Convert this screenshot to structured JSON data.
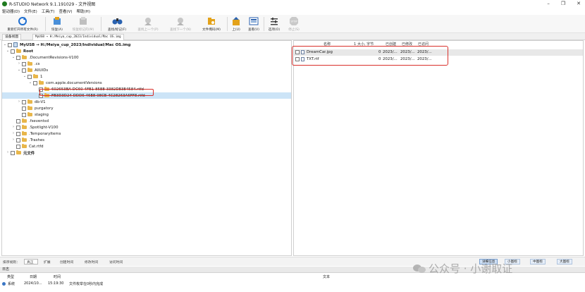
{
  "window": {
    "title": "R-STUDIO Network 9.1.191029 - 文件视图",
    "controls": [
      "–",
      "❐",
      "✕"
    ]
  },
  "menu": [
    "驱动器(D)",
    "文件(E)",
    "工具(T)",
    "查看(V)",
    "帮助(H)"
  ],
  "toolbar": [
    {
      "label": "重新打开所有文件(R)",
      "icon": "refresh-icon",
      "enabled": true
    },
    {
      "label": "恢复(A)",
      "icon": "recover-icon",
      "enabled": true
    },
    {
      "label": "恢复标记的(M)",
      "icon": "recover-marked-icon",
      "enabled": false
    },
    {
      "label": "查找/标记(F)",
      "icon": "binoculars-icon",
      "enabled": true
    },
    {
      "label": "查找上一个(P)",
      "icon": "find-prev-icon",
      "enabled": false
    },
    {
      "label": "查找下一个(N)",
      "icon": "find-next-icon",
      "enabled": false
    },
    {
      "label": "文件掩码(M)",
      "icon": "file-mask-icon",
      "enabled": true
    },
    {
      "label": "上(U)",
      "icon": "up-icon",
      "enabled": true
    },
    {
      "label": "查看(V)",
      "icon": "view-icon",
      "enabled": true
    },
    {
      "label": "选项(O)",
      "icon": "options-icon",
      "enabled": true
    },
    {
      "label": "停止(S)",
      "icon": "stop-icon",
      "enabled": false
    }
  ],
  "tabs": [
    {
      "label": "设备视图"
    },
    {
      "label": "MyUSB → H:/Meiya_cup_2023/Individual/Mac OS.img"
    }
  ],
  "tree": [
    {
      "label": "MyUSB → H:/Meiya_cup_2023/Individual/Mac OS.img",
      "bold": true,
      "expanded": true,
      "type": "drive",
      "highlight": false
    },
    {
      "label": "Root",
      "bold": true,
      "expanded": true,
      "type": "folder",
      "highlight": false
    },
    {
      "label": ".DocumentRevisions-V100",
      "expanded": true,
      "type": "folder",
      "highlight": false
    },
    {
      "label": ".cs",
      "expanded": false,
      "type": "folder",
      "highlight": false
    },
    {
      "label": "AllUIDs",
      "expanded": true,
      "type": "folder",
      "highlight": false
    },
    {
      "label": "1",
      "expanded": true,
      "type": "folder",
      "highlight": false
    },
    {
      "label": "com.apple.documentVersions",
      "expanded": true,
      "type": "folder",
      "highlight": false
    },
    {
      "label": "602653BA-DC60-4FB1-85EE-3382DE3E4584.rtfd",
      "type": "folder",
      "highlight": false
    },
    {
      "label": "FB3D3D24-DDD6-46E8-98CE-4C28263A6FF8.rtfd",
      "type": "folder",
      "highlight": true
    },
    {
      "label": "db-V1",
      "expanded": false,
      "type": "folder",
      "highlight": false
    },
    {
      "label": "purgatory",
      "type": "folder",
      "highlight": false
    },
    {
      "label": "staging",
      "type": "folder",
      "highlight": false
    },
    {
      "label": ".fseventsd",
      "type": "folder",
      "highlight": false
    },
    {
      "label": ".Spotlight-V100",
      "expanded": false,
      "type": "folder",
      "highlight": false
    },
    {
      "label": ".TemporaryItems",
      "expanded": false,
      "type": "folder",
      "highlight": false
    },
    {
      "label": ".Trashes",
      "expanded": false,
      "type": "folder",
      "highlight": false
    },
    {
      "label": "Cat.rtfd",
      "type": "folder",
      "highlight": false
    },
    {
      "label": "元文件",
      "bold": true,
      "expanded": false,
      "type": "folder",
      "highlight": false
    }
  ],
  "file_list": {
    "columns": [
      "名称",
      "1",
      "大小, 字节",
      "已创建",
      "已修改",
      "已访问"
    ],
    "rows": [
      {
        "name": "DreamCar.jpg",
        "size": "0",
        "created": "2023/...",
        "modified": "2023/...",
        "accessed": "2023/..."
      },
      {
        "name": "TXT.rtf",
        "size": "0",
        "created": "2023/...",
        "modified": "2023/...",
        "accessed": "2023/..."
      }
    ]
  },
  "statusbar": {
    "sort_label": "排序规则：",
    "sort_options": [
      "真正",
      "扩展",
      "创建时间",
      "修改时间",
      "访问时间"
    ],
    "view_buttons": [
      "详细信息",
      "小图标",
      "中图标",
      "大图标"
    ]
  },
  "log": {
    "title": "日志",
    "columns": [
      "类型",
      "日期",
      "时间",
      "文本"
    ],
    "rows": [
      {
        "type": "系统",
        "date": "2024/10...",
        "time": "15:19:30",
        "text": "文件枚举在0秒内完成"
      }
    ]
  },
  "watermark": "公众号 · 小谢取证",
  "colors": {
    "highlight_box": "#d9302b",
    "selection": "#cce4f7",
    "folder": "#e8b64a"
  }
}
